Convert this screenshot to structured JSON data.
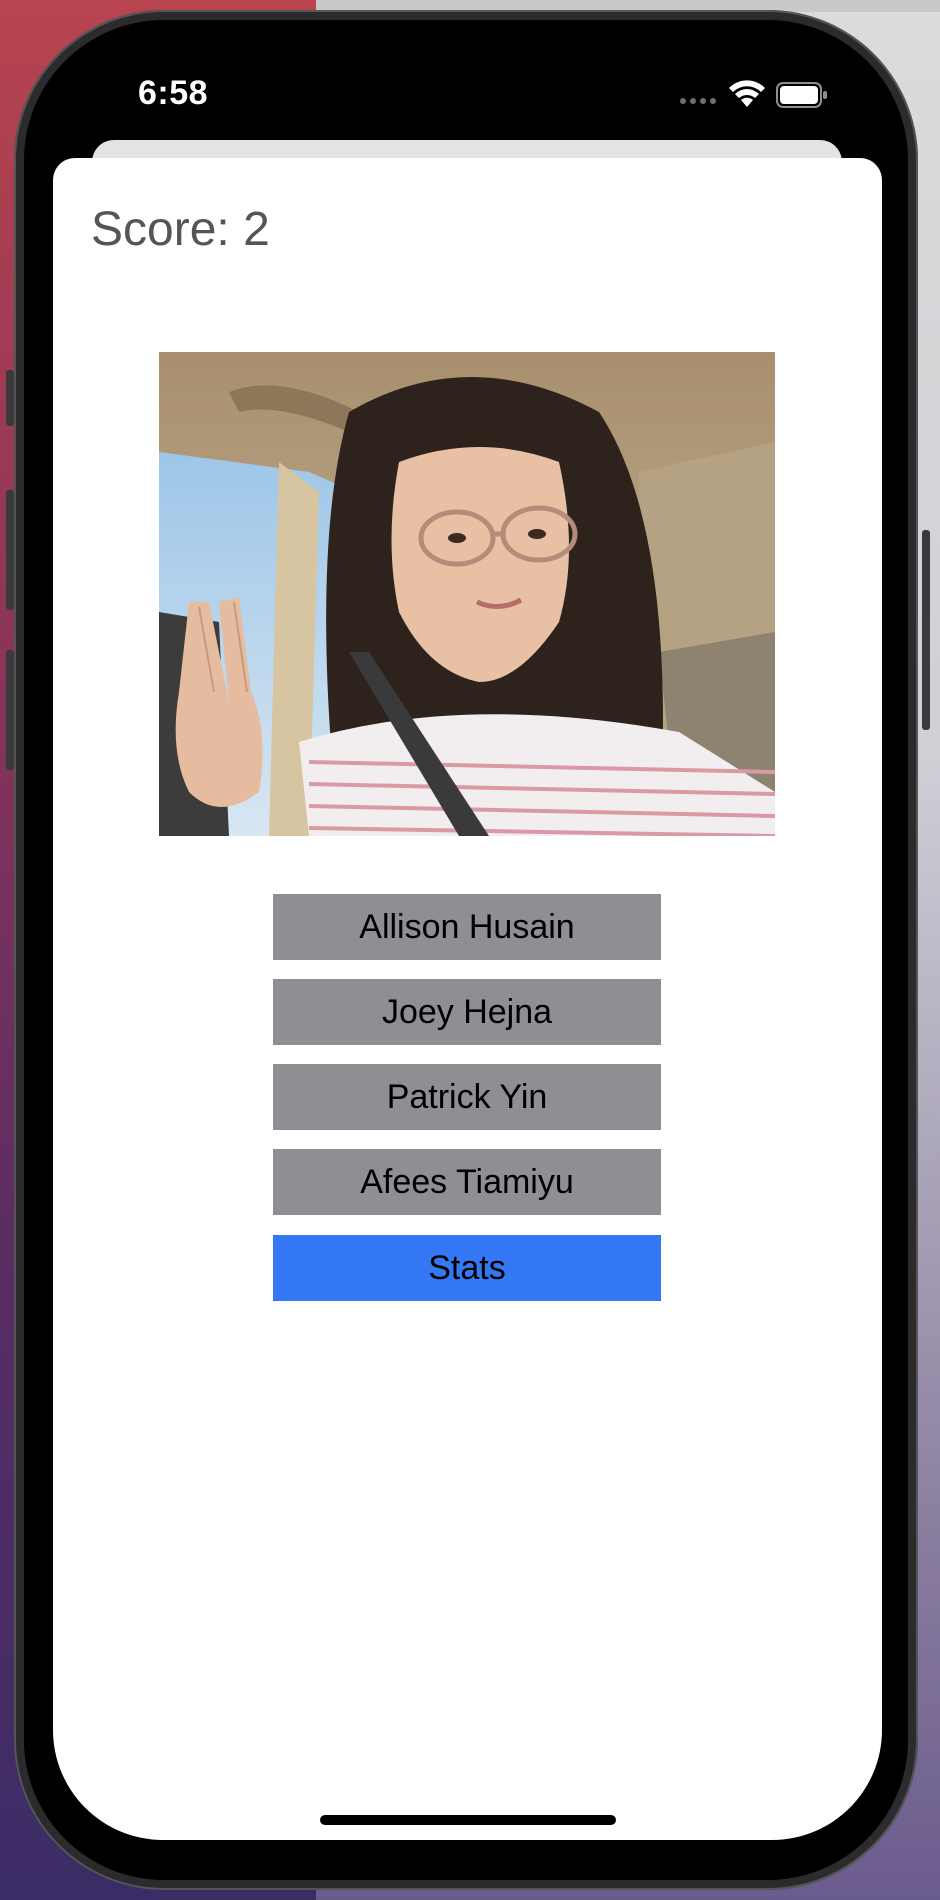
{
  "status_bar": {
    "time": "6:58",
    "icons": [
      "cellular-signal-icon",
      "wifi-icon",
      "battery-icon"
    ]
  },
  "score": {
    "label": "Score: 2"
  },
  "photo": {
    "icon": "person-photo"
  },
  "choices": [
    {
      "label": "Allison Husain"
    },
    {
      "label": "Joey Hejna"
    },
    {
      "label": "Patrick Yin"
    },
    {
      "label": "Afees Tiamiyu"
    }
  ],
  "stats_button": {
    "label": "Stats",
    "color": "#3478f6"
  },
  "colors": {
    "choice_button": "#8e8e93",
    "score_text": "#555555",
    "sheet_background": "#ffffff"
  }
}
